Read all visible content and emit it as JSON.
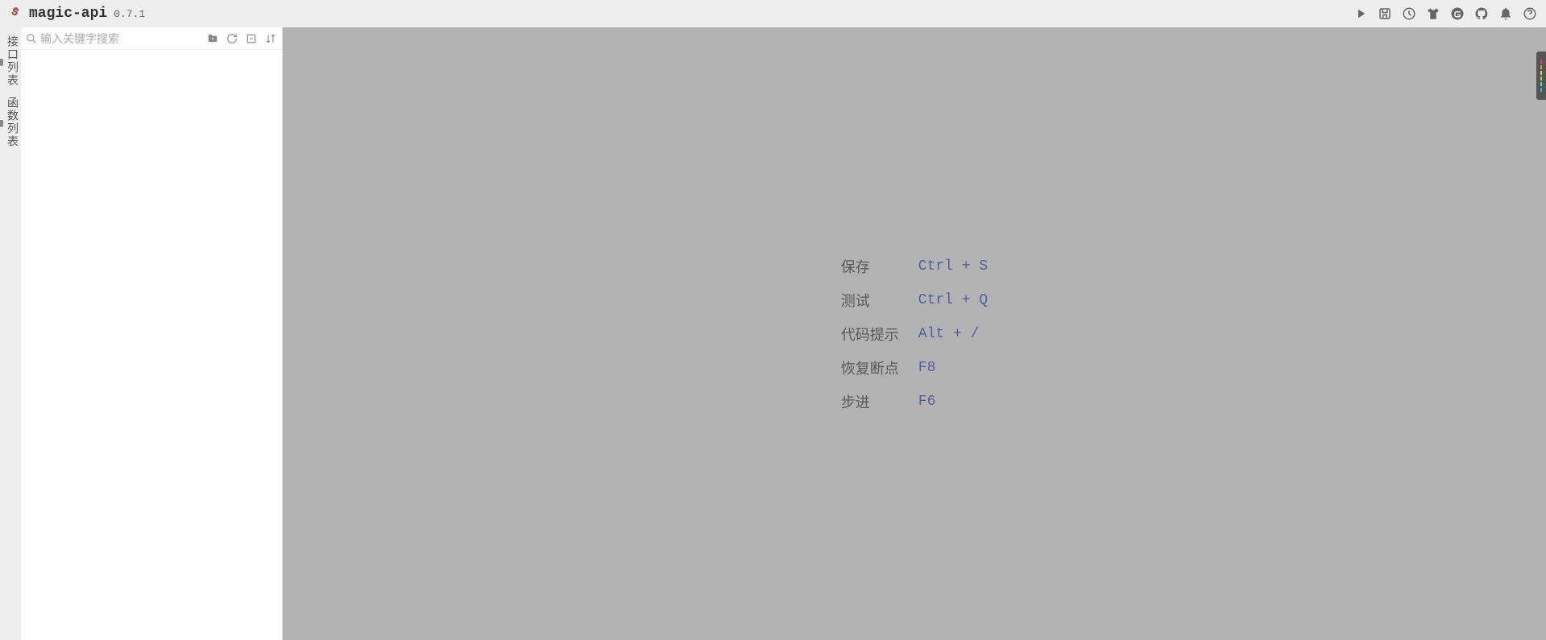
{
  "header": {
    "title": "magic-api",
    "version": "0.7.1"
  },
  "verticalTabs": [
    {
      "label": "接口列表"
    },
    {
      "label": "函数列表"
    }
  ],
  "sidebar": {
    "searchPlaceholder": "输入关键字搜索"
  },
  "shortcuts": [
    {
      "label": "保存",
      "key": "Ctrl + S"
    },
    {
      "label": "测试",
      "key": "Ctrl + Q"
    },
    {
      "label": "代码提示",
      "key": "Alt + /"
    },
    {
      "label": "恢复断点",
      "key": "F8"
    },
    {
      "label": "步进",
      "key": "F6"
    }
  ]
}
